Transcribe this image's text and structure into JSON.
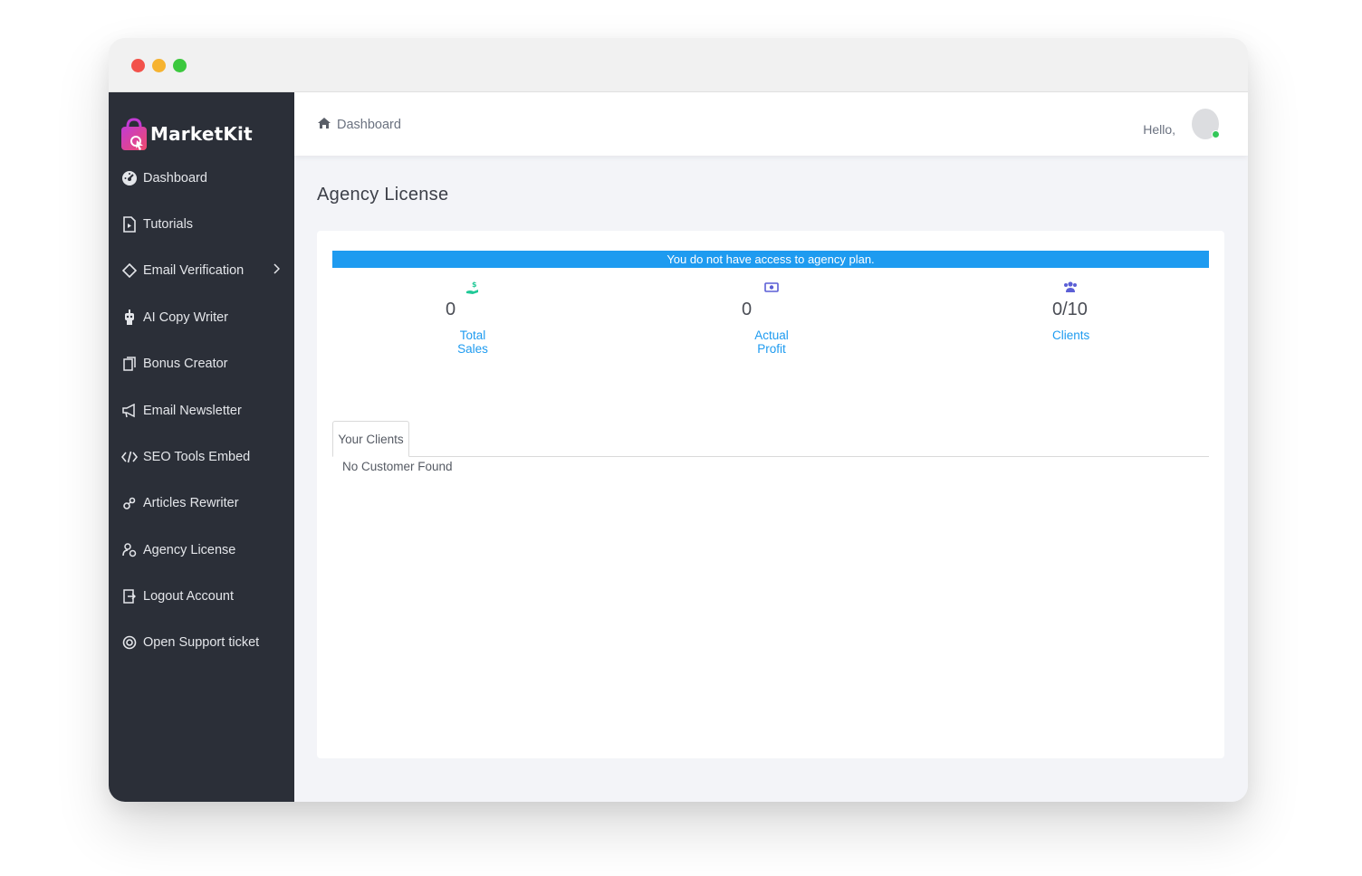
{
  "app": {
    "brand": "MarketKit"
  },
  "sidebar": {
    "items": [
      {
        "label": "Dashboard",
        "icon": "gauge-icon"
      },
      {
        "label": "Tutorials",
        "icon": "video-file-icon"
      },
      {
        "label": "Email Verification",
        "icon": "diamond-icon",
        "has_submenu": true
      },
      {
        "label": "AI Copy Writer",
        "icon": "robot-icon"
      },
      {
        "label": "Bonus Creator",
        "icon": "copy-icon"
      },
      {
        "label": "Email Newsletter",
        "icon": "megaphone-icon"
      },
      {
        "label": "SEO Tools Embed",
        "icon": "code-icon"
      },
      {
        "label": "Articles Rewriter",
        "icon": "gears-icon"
      },
      {
        "label": "Agency License",
        "icon": "users-cog-icon"
      },
      {
        "label": "Logout Account",
        "icon": "door-exit-icon"
      },
      {
        "label": "Open Support ticket",
        "icon": "lifebuoy-icon"
      }
    ]
  },
  "header": {
    "breadcrumb": "Dashboard",
    "greeting": "Hello,"
  },
  "page": {
    "title": "Agency License",
    "alert": "You do not have access to agency plan.",
    "stats": [
      {
        "value": "0",
        "label": "Total Sales",
        "icon": "hand-dollar-icon"
      },
      {
        "value": "0",
        "label": "Actual Profit",
        "icon": "money-bill-icon"
      },
      {
        "value": "0/10",
        "label": "Clients",
        "icon": "users-icon"
      }
    ],
    "tabs": [
      {
        "label": "Your Clients"
      }
    ],
    "empty_message": "No Customer Found"
  },
  "colors": {
    "sidebar_bg": "#2b2f38",
    "accent": "#1e9bf0",
    "status_online": "#34c759"
  }
}
